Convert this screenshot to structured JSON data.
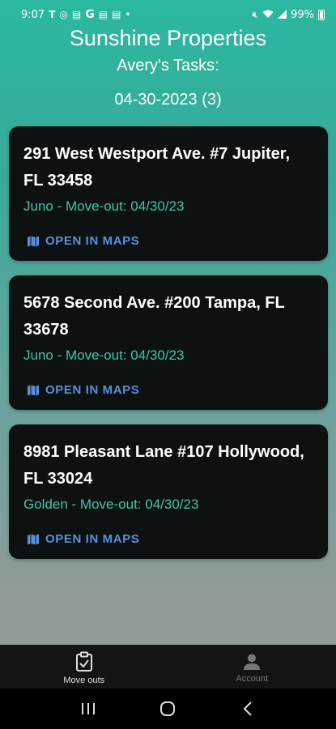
{
  "status_bar": {
    "time": "9:07",
    "carrier_icon": "T",
    "battery_pct": "99%"
  },
  "header": {
    "app_title": "Sunshine Properties",
    "subtitle": "Avery's Tasks:",
    "date_line": "04-30-2023 (3)"
  },
  "cards": [
    {
      "address": "291 West Westport Ave. #7 Jupiter, FL 33458",
      "detail": "Juno - Move-out: 04/30/23",
      "maps_label": "OPEN IN MAPS"
    },
    {
      "address": "5678 Second Ave. #200 Tampa, FL 33678",
      "detail": "Juno - Move-out: 04/30/23",
      "maps_label": "OPEN IN MAPS"
    },
    {
      "address": "8981 Pleasant Lane #107 Hollywood, FL 33024",
      "detail": "Golden - Move-out: 04/30/23",
      "maps_label": "OPEN IN MAPS"
    }
  ],
  "bottom_nav": {
    "items": [
      {
        "label": "Move outs",
        "icon": "clipboard-check-icon",
        "active": true
      },
      {
        "label": "Account",
        "icon": "person-icon",
        "active": false
      }
    ]
  },
  "colors": {
    "accent_teal": "#3fc6a8",
    "link_blue": "#5b8fd9",
    "card_bg": "#0d1112"
  }
}
